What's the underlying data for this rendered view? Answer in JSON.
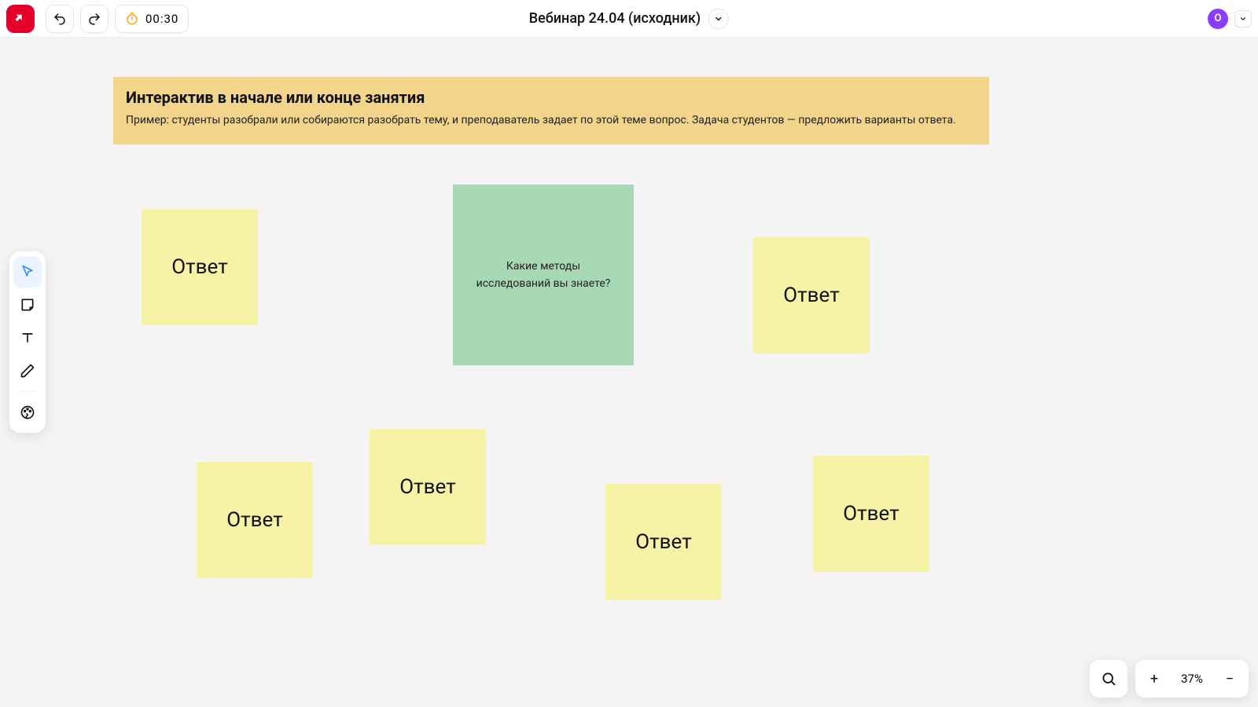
{
  "header": {
    "timer": "00:30",
    "title": "Вебинар 24.04 (исходник)",
    "avatar_letter": "O"
  },
  "banner": {
    "title": "Интерактив в начале или конце занятия",
    "subtitle": "Пример: студенты разобрали или собираются разобрать тему, и преподаватель задает по этой теме вопрос. Задача студентов — предложить варианты ответа."
  },
  "question_note": {
    "text": "Какие методы исследований вы знаете?"
  },
  "answer_label": "Ответ",
  "zoom": {
    "level": "37%",
    "plus": "+",
    "minus": "−"
  }
}
